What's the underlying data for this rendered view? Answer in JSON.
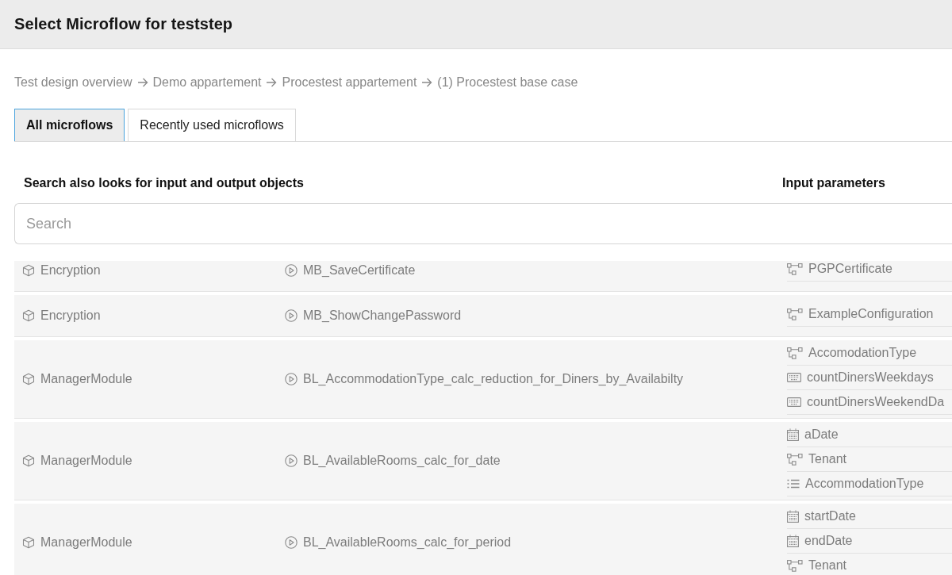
{
  "dialog": {
    "title": "Select Microflow for teststep"
  },
  "breadcrumb": [
    "Test design overview",
    "Demo appartement",
    "Procestest appartement",
    "(1) Procestest base case"
  ],
  "tabs": [
    {
      "label": "All microflows",
      "selected": true
    },
    {
      "label": "Recently used microflows",
      "selected": false
    }
  ],
  "search_hint": "Search also looks for input and output objects",
  "input_parameters_heading": "Input parameters",
  "search": {
    "placeholder": "Search"
  },
  "microflows": [
    {
      "module": "Encryption",
      "name": "MB_SaveCertificate",
      "parameters": [
        {
          "kind": "entity",
          "name": "PGPCertificate"
        }
      ]
    },
    {
      "module": "Encryption",
      "name": "MB_ShowChangePassword",
      "parameters": [
        {
          "kind": "entity",
          "name": "ExampleConfiguration"
        }
      ]
    },
    {
      "module": "ManagerModule",
      "name": "BL_AccommodationType_calc_reduction_for_Diners_by_Availabilty",
      "parameters": [
        {
          "kind": "entity",
          "name": "AccomodationType"
        },
        {
          "kind": "number",
          "name": "countDinersWeekdays"
        },
        {
          "kind": "number",
          "name": "countDinersWeekendDa"
        }
      ]
    },
    {
      "module": "ManagerModule",
      "name": "BL_AvailableRooms_calc_for_date",
      "parameters": [
        {
          "kind": "date",
          "name": "aDate"
        },
        {
          "kind": "entity",
          "name": "Tenant"
        },
        {
          "kind": "list",
          "name": "AccommodationType"
        }
      ]
    },
    {
      "module": "ManagerModule",
      "name": "BL_AvailableRooms_calc_for_period",
      "parameters": [
        {
          "kind": "date",
          "name": "startDate"
        },
        {
          "kind": "date",
          "name": "endDate"
        },
        {
          "kind": "entity",
          "name": "Tenant"
        }
      ]
    }
  ]
}
